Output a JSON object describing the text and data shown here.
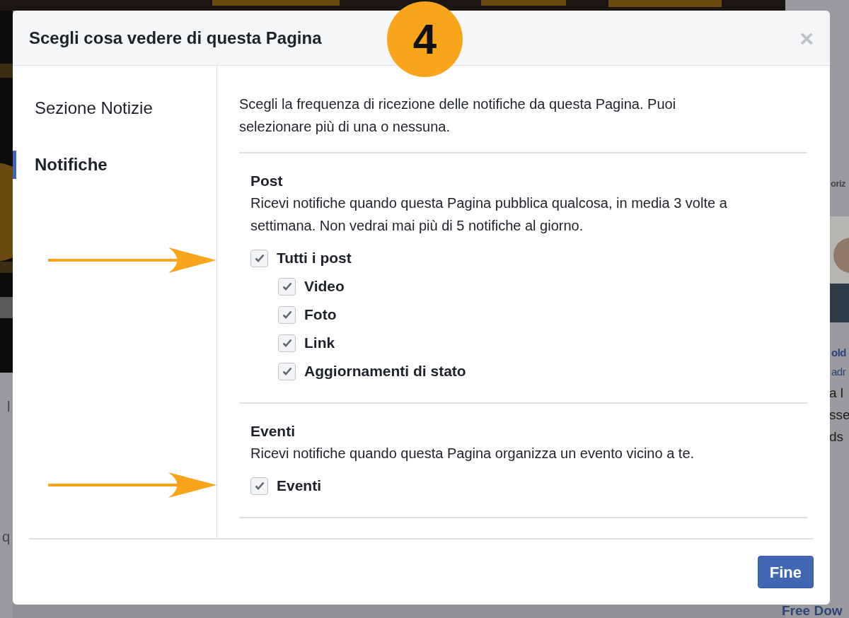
{
  "background": {
    "right_heading": "oriz",
    "right_name": "old",
    "right_sub": "adr",
    "right_lines": [
      "a l",
      "sse",
      "ds"
    ],
    "right_link": "Free Dow",
    "left_tab": "l",
    "left_line": "q"
  },
  "dialog": {
    "title": "Scegli cosa vedere di questa Pagina",
    "close": "×",
    "step_badge": "4",
    "nav": [
      {
        "label": "Sezione Notizie",
        "selected": false
      },
      {
        "label": "Notifiche",
        "selected": true
      }
    ],
    "intro": "Scegli la frequenza di ricezione delle notifiche da questa Pagina. Puoi selezionare più di una o nessuna.",
    "sections": [
      {
        "title": "Post",
        "description": "Ricevi notifiche quando questa Pagina pubblica qualcosa, in media 3 volte a settimana. Non vedrai mai più di 5 notifiche al giorno.",
        "options": [
          {
            "label": "Tutti i post",
            "checked": true,
            "children": [
              {
                "label": "Video",
                "checked": true
              },
              {
                "label": "Foto",
                "checked": true
              },
              {
                "label": "Link",
                "checked": true
              },
              {
                "label": "Aggiornamenti di stato",
                "checked": true
              }
            ]
          }
        ]
      },
      {
        "title": "Eventi",
        "description": "Ricevi notifiche quando questa Pagina organizza un evento vicino a te.",
        "options": [
          {
            "label": "Eventi",
            "checked": true
          }
        ]
      }
    ],
    "button": "Fine"
  }
}
